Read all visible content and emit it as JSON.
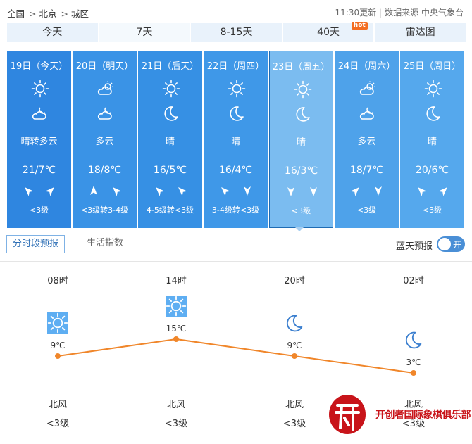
{
  "breadcrumb": [
    "全国",
    "北京",
    "城区"
  ],
  "breadcrumb_sep": ">",
  "update_time": "11:30更新",
  "source": "数据来源 中央气象台",
  "tabs": [
    {
      "label": "今天"
    },
    {
      "label": "7天",
      "active": true
    },
    {
      "label": "8-15天"
    },
    {
      "label": "40天",
      "badge": "hot"
    },
    {
      "label": "雷达图"
    }
  ],
  "days": [
    {
      "date": "19日（今天）",
      "day_icon": "sun-icon",
      "night_icon": "cloudy-night-icon",
      "desc": "晴转多云",
      "temp": "21/7℃",
      "wind": "<3级",
      "color": "#2f86e0",
      "selected": false
    },
    {
      "date": "20日（明天）",
      "day_icon": "partly-cloudy-icon",
      "night_icon": "cloudy-night-icon",
      "desc": "多云",
      "temp": "18/8℃",
      "wind": "<3级转3-4级",
      "color": "#3a93e6",
      "selected": false
    },
    {
      "date": "21日（后天）",
      "day_icon": "sun-icon",
      "night_icon": "moon-icon",
      "desc": "晴",
      "temp": "16/5℃",
      "wind": "4-5级转<3级",
      "color": "#3690e4",
      "selected": false
    },
    {
      "date": "22日（周四）",
      "day_icon": "sun-icon",
      "night_icon": "moon-icon",
      "desc": "晴",
      "temp": "16/4℃",
      "wind": "3-4级转<3级",
      "color": "#3f98e8",
      "selected": false
    },
    {
      "date": "23日（周五）",
      "day_icon": "sun-icon",
      "night_icon": "moon-icon",
      "desc": "晴",
      "temp": "16/3℃",
      "wind": "<3级",
      "color": "#7bbcf0",
      "selected": true
    },
    {
      "date": "24日（周六）",
      "day_icon": "partly-cloudy-icon",
      "night_icon": "cloudy-night-icon",
      "desc": "多云",
      "temp": "18/7℃",
      "wind": "<3级",
      "color": "#4ea2ea",
      "selected": false
    },
    {
      "date": "25日（周日）",
      "day_icon": "sun-icon",
      "night_icon": "moon-icon",
      "desc": "晴",
      "temp": "20/6℃",
      "wind": "<3级",
      "color": "#55a8ed",
      "selected": false
    }
  ],
  "subtabs": [
    "分时段预报",
    "生活指数"
  ],
  "bluesky_label": "蓝天预报",
  "toggle_label": "开",
  "hourly": [
    {
      "time": "08时",
      "icon": "sun-icon",
      "temp": "9℃",
      "wind_dir": "北风",
      "wind_level": "<3级"
    },
    {
      "time": "14时",
      "icon": "sun-icon",
      "temp": "15℃",
      "wind_dir": "北风",
      "wind_level": "<3级"
    },
    {
      "time": "20时",
      "icon": "moon-icon",
      "temp": "9℃",
      "wind_dir": "北风",
      "wind_level": "<3级"
    },
    {
      "time": "02时",
      "icon": "moon-icon",
      "temp": "3℃",
      "wind_dir": "北风",
      "wind_level": "<3级"
    }
  ],
  "chart_data": {
    "type": "line",
    "x": [
      "08时",
      "14时",
      "20时",
      "02时"
    ],
    "series": [
      {
        "values": [
          9,
          15,
          9,
          3
        ]
      }
    ],
    "color": "#f0862a"
  },
  "watermark": {
    "text": "开创者国际象棋俱乐部",
    "seal": "开创"
  },
  "colors": {
    "tab_bg": "#e9f2fb",
    "accent": "#2c6eb5",
    "line": "#f0862a"
  }
}
